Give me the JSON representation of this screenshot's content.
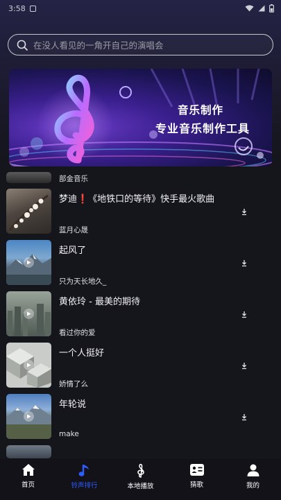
{
  "status_bar": {
    "time": "3:58"
  },
  "search": {
    "placeholder": "在没人看见的一角开自己的演唱会"
  },
  "banner": {
    "title": "音乐制作",
    "subtitle": "专业音乐制作工具"
  },
  "partial_item": {
    "artist": "部金音乐"
  },
  "songs": [
    {
      "title": "梦迪❗《地铁口的等待》快手最火歌曲",
      "artist": "蓝月心晟"
    },
    {
      "title": "起风了",
      "artist": "只为天长地久_"
    },
    {
      "title": "黄依玲 - 最美的期待",
      "artist": "看过你的爱"
    },
    {
      "title": "一个人挺好",
      "artist": "娇情了么"
    },
    {
      "title": "年轮说",
      "artist": "make"
    }
  ],
  "tabs": [
    {
      "label": "首页",
      "icon": "home-icon"
    },
    {
      "label": "铃声排行",
      "icon": "music-note-icon",
      "active": true
    },
    {
      "label": "本地播放",
      "icon": "treble-clef-icon"
    },
    {
      "label": "猜歌",
      "icon": "quiz-card-icon"
    },
    {
      "label": "我的",
      "icon": "profile-icon"
    }
  ],
  "colors": {
    "accent": "#2f5bff",
    "background": "#15151c"
  }
}
